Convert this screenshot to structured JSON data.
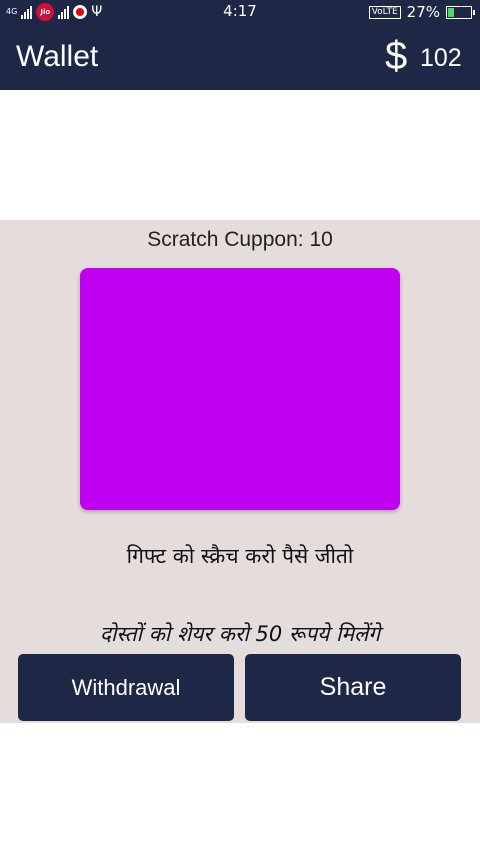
{
  "status_bar": {
    "network_tag": "4G",
    "carrier_logo": "Jio",
    "time": "4:17",
    "volte": "VoLTE",
    "battery_percent": "27%",
    "battery_level": 0.27,
    "icons": [
      "signal-icon",
      "jio-icon",
      "vodafone-icon",
      "usb-icon",
      "battery-charging-icon"
    ]
  },
  "app_bar": {
    "title": "Wallet",
    "currency_symbol": "$",
    "balance": "102"
  },
  "main": {
    "coupon_label": "Scratch Cuppon: 10",
    "gift_text": "गिफ्ट को स्क्रैच करो पैसे जीतो",
    "share_text": "दोस्तों को शेयर करो 50 रूपये  मिलेंगे"
  },
  "buttons": {
    "withdrawal": "Withdrawal",
    "share": "Share"
  },
  "colors": {
    "app_bar": "#1e2746",
    "content_background": "#e5dcdc",
    "scratch_card": "#c000f0",
    "button": "#1e2746"
  }
}
